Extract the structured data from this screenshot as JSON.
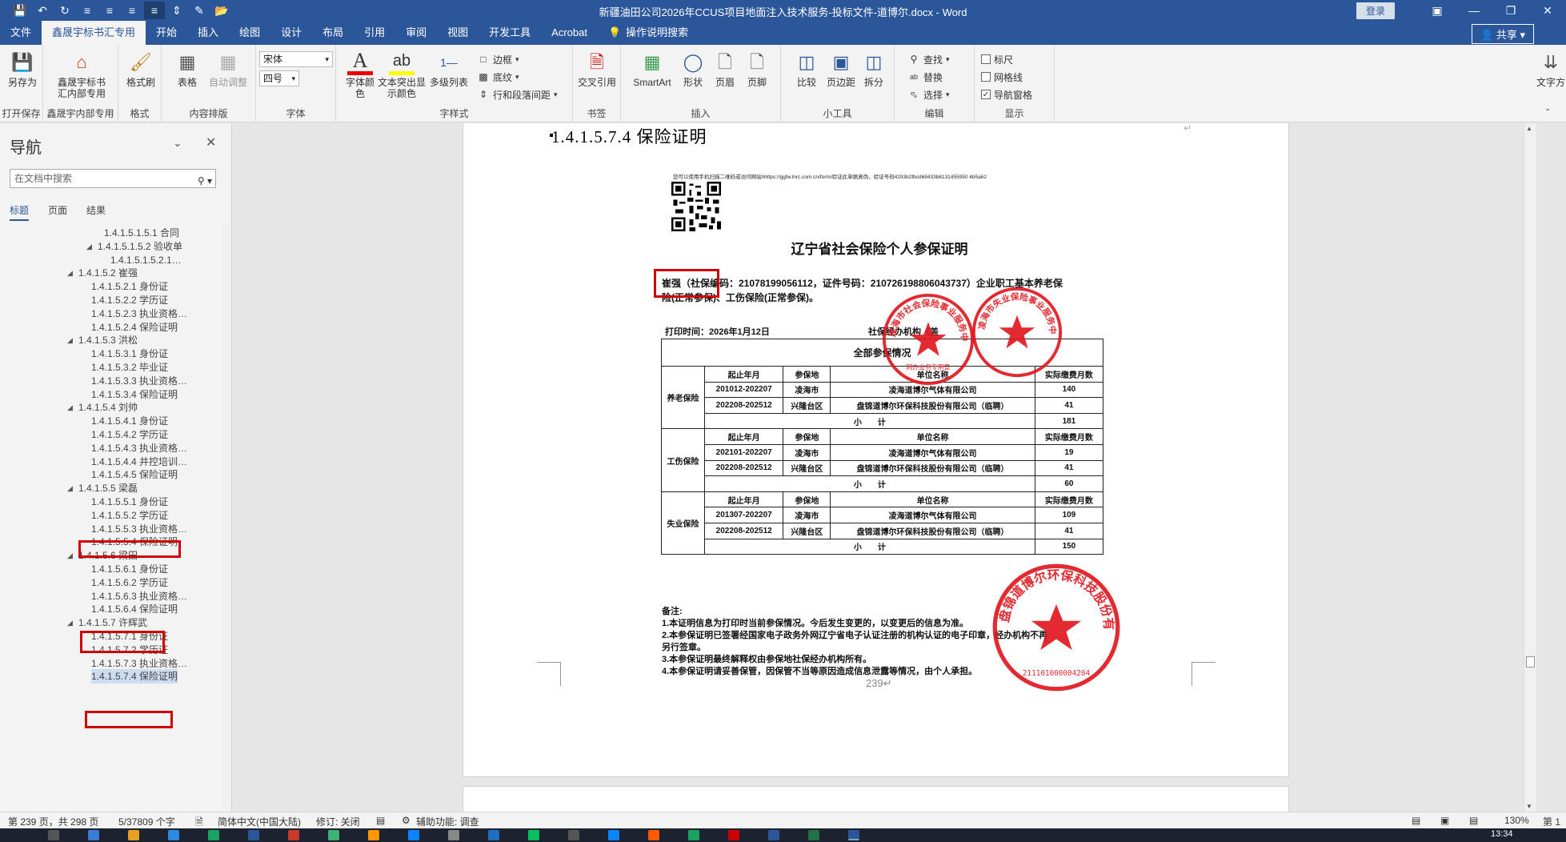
{
  "window": {
    "title": "新疆油田公司2026年CCUS项目地面注入技术服务-投标文件-道博尔.docx - Word",
    "login": "登录",
    "share": "共享"
  },
  "tabs": [
    "文件",
    "鑫晟宇标书汇专用",
    "开始",
    "插入",
    "绘图",
    "设计",
    "布局",
    "引用",
    "审阅",
    "视图",
    "开发工具",
    "Acrobat"
  ],
  "tab_help": "操作说明搜索",
  "ribbon": {
    "save_as": "另存为",
    "group_open_save": "打开保存",
    "xsy_internal": "鑫晟宇标书汇内部专用",
    "group_xsy": "鑫晟宇内部专用",
    "format_brush": "格式刷",
    "group_format": "格式",
    "table": "表格",
    "auto_adjust": "自动调整",
    "group_layout": "内容排版",
    "font_name": "宋体",
    "font_size": "四号",
    "group_font": "字体",
    "font_color": "字体颜色",
    "highlight": "文本突出显示颜色",
    "multilevel": "多级列表",
    "border": "边框",
    "shading": "底纹",
    "line_spacing": "行和段落间距",
    "group_style": "字样式",
    "cross_ref": "交叉引用",
    "group_bookmark": "书签",
    "smartart": "SmartArt",
    "shape": "形状",
    "header": "页眉",
    "footer": "页脚",
    "group_insert": "插入",
    "compare": "比较",
    "page_border": "页边距",
    "split": "拆分",
    "group_tools": "小工具",
    "find": "查找",
    "replace": "替换",
    "select": "选择",
    "group_edit": "编辑",
    "ruler": "标尺",
    "gridlines": "网格线",
    "nav_pane": "导航窗格",
    "group_show": "显示",
    "text_dir": "文字方"
  },
  "nav": {
    "title": "导航",
    "search_placeholder": "在文档中搜索",
    "tabs": [
      "标题",
      "页面",
      "结果"
    ],
    "items": [
      {
        "text": "1.4.1.5.1.5.1 合同",
        "indent": 5,
        "tri": ""
      },
      {
        "text": "1.4.1.5.1.5.2 验收单",
        "indent": 4,
        "tri": "◢"
      },
      {
        "text": "1.4.1.5.1.5.2.1…",
        "indent": 6,
        "tri": ""
      },
      {
        "text": "1.4.1.5.2 崔强",
        "indent": 1,
        "tri": "◢"
      },
      {
        "text": "1.4.1.5.2.1 身份证",
        "indent": 3,
        "tri": ""
      },
      {
        "text": "1.4.1.5.2.2 学历证",
        "indent": 3,
        "tri": ""
      },
      {
        "text": "1.4.1.5.2.3 执业资格…",
        "indent": 3,
        "tri": ""
      },
      {
        "text": "1.4.1.5.2.4 保险证明",
        "indent": 3,
        "tri": ""
      },
      {
        "text": "1.4.1.5.3 洪松",
        "indent": 1,
        "tri": "◢"
      },
      {
        "text": "1.4.1.5.3.1 身份证",
        "indent": 3,
        "tri": ""
      },
      {
        "text": "1.4.1.5.3.2 毕业证",
        "indent": 3,
        "tri": ""
      },
      {
        "text": "1.4.1.5.3.3 执业资格…",
        "indent": 3,
        "tri": ""
      },
      {
        "text": "1.4.1.5.3.4 保险证明",
        "indent": 3,
        "tri": ""
      },
      {
        "text": "1.4.1.5.4 刘帅",
        "indent": 1,
        "tri": "◢"
      },
      {
        "text": "1.4.1.5.4.1 身份证",
        "indent": 3,
        "tri": ""
      },
      {
        "text": "1.4.1.5.4.2 学历证",
        "indent": 3,
        "tri": ""
      },
      {
        "text": "1.4.1.5.4.3 执业资格…",
        "indent": 3,
        "tri": ""
      },
      {
        "text": "1.4.1.5.4.4 井控培训…",
        "indent": 3,
        "tri": ""
      },
      {
        "text": "1.4.1.5.4.5 保险证明",
        "indent": 3,
        "tri": ""
      },
      {
        "text": "1.4.1.5.5 梁磊",
        "indent": 1,
        "tri": "◢"
      },
      {
        "text": "1.4.1.5.5.1 身份证",
        "indent": 3,
        "tri": ""
      },
      {
        "text": "1.4.1.5.5.2 学历证",
        "indent": 3,
        "tri": ""
      },
      {
        "text": "1.4.1.5.5.3 执业资格…",
        "indent": 3,
        "tri": ""
      },
      {
        "text": "1.4.1.5.5.4 保险证明",
        "indent": 3,
        "tri": ""
      },
      {
        "text": "1.4.1.5.6 梁田",
        "indent": 1,
        "tri": "◢"
      },
      {
        "text": "1.4.1.5.6.1 身份证",
        "indent": 3,
        "tri": ""
      },
      {
        "text": "1.4.1.5.6.2 学历证",
        "indent": 3,
        "tri": ""
      },
      {
        "text": "1.4.1.5.6.3 执业资格…",
        "indent": 3,
        "tri": ""
      },
      {
        "text": "1.4.1.5.6.4 保险证明",
        "indent": 3,
        "tri": ""
      },
      {
        "text": "1.4.1.5.7 许辉武",
        "indent": 1,
        "tri": "◢"
      },
      {
        "text": "1.4.1.5.7.1 身份证",
        "indent": 3,
        "tri": ""
      },
      {
        "text": "1.4.1.5.7.2 学历证",
        "indent": 3,
        "tri": ""
      },
      {
        "text": "1.4.1.5.7.3 执业资格…",
        "indent": 3,
        "tri": ""
      },
      {
        "text": "1.4.1.5.7.4 保险证明",
        "indent": 3,
        "tri": "",
        "selected": true
      }
    ]
  },
  "document": {
    "heading": "1.4.1.5.7.4 保险证明",
    "cert": {
      "qr_note": "您可以使用手机扫描二维码或访问网站hhttps://ggfw.lnrc.com.cn/form/验证此单据真伪，验证号码4293b2fbcd68433b8131455950 4b5a62",
      "title": "辽宁省社会保险个人参保证明",
      "body_line1": "崔强（社保编码：21078199056112，证件号码：210726198806043737）企业职工基本养老保",
      "body_line2": "险(正常参保)、工伤保险(正常参保)。",
      "print_time": "打印时间：2026年1月12日",
      "agency": "社保经办机构（盖",
      "table_title": "全部参保情况",
      "col_headers": [
        "起止年月",
        "参保地",
        "单位名称",
        "实际缴费月数"
      ],
      "sections": [
        {
          "category": "养老保险",
          "rows": [
            [
              "201012-202207",
              "凌海市",
              "凌海道博尔气体有限公司",
              "140"
            ],
            [
              "202208-202512",
              "兴隆台区",
              "盘锦道博尔环保科技股份有限公司（临聘）",
              "41"
            ]
          ],
          "subtotal_label": "小　　计",
          "subtotal": "181"
        },
        {
          "category": "工伤保险",
          "rows": [
            [
              "202101-202207",
              "凌海市",
              "凌海道博尔气体有限公司",
              "19"
            ],
            [
              "202208-202512",
              "兴隆台区",
              "盘锦道博尔环保科技股份有限公司（临聘）",
              "41"
            ]
          ],
          "subtotal_label": "小　　计",
          "subtotal": "60"
        },
        {
          "category": "失业保险",
          "rows": [
            [
              "201307-202207",
              "凌海市",
              "凌海道博尔气体有限公司",
              "109"
            ],
            [
              "202208-202512",
              "兴隆台区",
              "盘锦道博尔环保科技股份有限公司（临聘）",
              "41"
            ]
          ],
          "subtotal_label": "小　　计",
          "subtotal": "150"
        }
      ],
      "notes_title": "备注:",
      "notes": [
        "1.本证明信息为打印时当前参保情况。今后发生变更的，以变更后的信息为准。",
        "2.本参保证明已签署经国家电子政务外网辽宁省电子认证注册的机构认证的电子印章，经办机构不再",
        "另行签章。",
        "3.本参保证明最终解释权由参保地社保经办机构所有。",
        "4.本参保证明请妥善保管，因保管不当等原因造成信息泄露等情况，由个人承担。"
      ],
      "seal1_text": "凌海市社会保险事业服务中心",
      "seal1_sub": "网办业务专用章",
      "seal2_text": "凌海市失业保险事业服务中心",
      "seal3_text": "盘锦道博尔环保科技股份有限公司",
      "seal3_num": "211101000004204"
    },
    "page_number": "239"
  },
  "status": {
    "page": "第 239 页，共 298 页",
    "words": "5/37809 个字",
    "lang": "简体中文(中国大陆)",
    "track": "修订: 关闭",
    "accessibility": "辅助功能: 调查",
    "zoom": "130%",
    "section": "第 1"
  },
  "taskbar": {
    "clock": "13:34"
  },
  "colors": {
    "brand": "#2b579a",
    "seal": "#e0141c",
    "highlight_box": "#d00000"
  }
}
